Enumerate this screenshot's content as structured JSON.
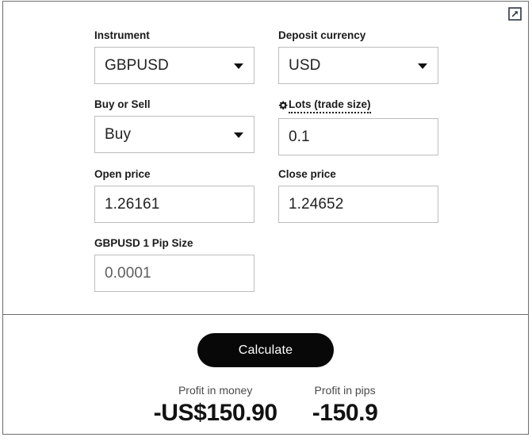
{
  "widget": {
    "expand_icon": "external-link-icon"
  },
  "form": {
    "instrument": {
      "label": "Instrument",
      "value": "GBPUSD",
      "caret": "chevron-down-icon"
    },
    "deposit_currency": {
      "label": "Deposit currency",
      "value": "USD",
      "caret": "chevron-down-icon"
    },
    "buy_or_sell": {
      "label": "Buy or Sell",
      "value": "Buy",
      "caret": "chevron-down-icon"
    },
    "lots": {
      "label": "Lots (trade size)",
      "value": "0.1",
      "icon": "gear-icon"
    },
    "open_price": {
      "label": "Open price",
      "value": "1.26161"
    },
    "close_price": {
      "label": "Close price",
      "value": "1.24652"
    },
    "pip_size": {
      "label": "GBPUSD 1 Pip Size",
      "value": "0.0001"
    }
  },
  "actions": {
    "calculate_label": "Calculate"
  },
  "results": [
    {
      "label": "Profit in money",
      "value": "-US$150.90"
    },
    {
      "label": "Profit in pips",
      "value": "-150.9"
    }
  ]
}
